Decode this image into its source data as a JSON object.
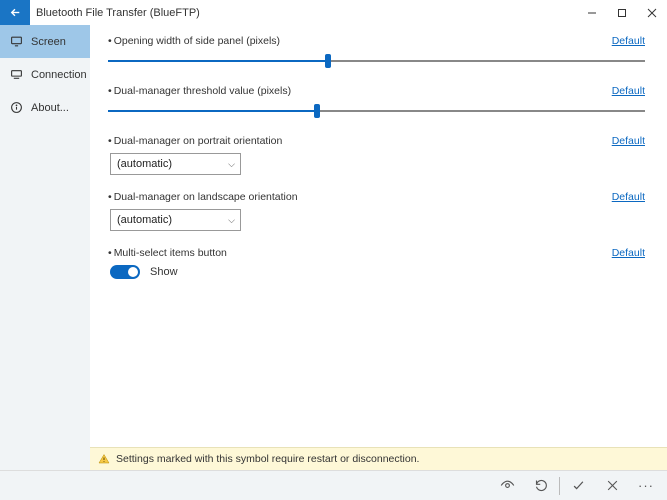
{
  "titlebar": {
    "app_name": "Bluetooth File Transfer (BlueFTP)"
  },
  "sidebar": {
    "items": [
      {
        "label": "Screen",
        "active": true
      },
      {
        "label": "Connection",
        "active": false
      },
      {
        "label": "About...",
        "active": false
      }
    ]
  },
  "settings": {
    "opening_width": {
      "label": "Opening width of side panel (pixels)",
      "default_label": "Default",
      "value_pct": 41
    },
    "dual_threshold": {
      "label": "Dual-manager threshold value (pixels)",
      "default_label": "Default",
      "value_pct": 39
    },
    "portrait": {
      "label": "Dual-manager on portrait orientation",
      "default_label": "Default",
      "selected": "(automatic)"
    },
    "landscape": {
      "label": "Dual-manager on landscape orientation",
      "default_label": "Default",
      "selected": "(automatic)"
    },
    "multiselect": {
      "label": "Multi-select items button",
      "default_label": "Default",
      "toggle_on": true,
      "toggle_text": "Show"
    }
  },
  "footer": {
    "warning_text": "Settings marked with this symbol require restart or disconnection."
  }
}
